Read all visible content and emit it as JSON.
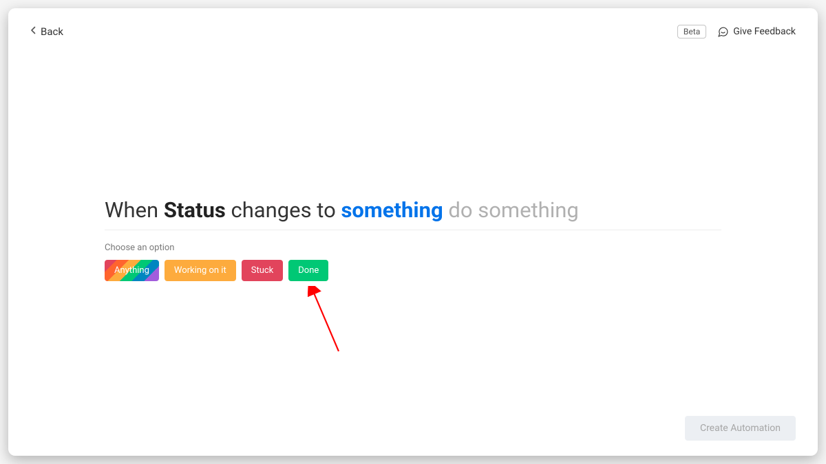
{
  "header": {
    "back_label": "Back",
    "beta_label": "Beta",
    "feedback_label": "Give Feedback"
  },
  "builder": {
    "tok_when": "When ",
    "tok_status": "Status",
    "tok_changes": " changes to ",
    "tok_something": "something",
    "tok_rest": " do something"
  },
  "picker": {
    "prompt": "Choose an option",
    "options": {
      "anything": "Anything",
      "working": "Working on it",
      "stuck": "Stuck",
      "done": "Done"
    }
  },
  "footer": {
    "create_label": "Create Automation"
  }
}
